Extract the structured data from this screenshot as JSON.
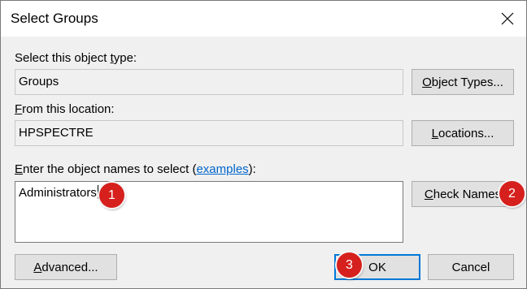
{
  "window": {
    "title": "Select Groups",
    "close_icon": "close-icon"
  },
  "object_type": {
    "label_pre": "Select this object ",
    "label_ul": "t",
    "label_post": "ype:",
    "value": "Groups",
    "button_pre": "",
    "button_ul": "O",
    "button_post": "bject Types..."
  },
  "location": {
    "label_pre": "",
    "label_ul": "F",
    "label_post": "rom this location:",
    "value": "HPSPECTRE",
    "button_pre": "",
    "button_ul": "L",
    "button_post": "ocations..."
  },
  "names": {
    "label_pre": "",
    "label_ul": "E",
    "label_post": "nter the object names to select (",
    "link": "examples",
    "label_end": "):",
    "value": "Administrators",
    "button_pre": "",
    "button_ul": "C",
    "button_post": "heck Names"
  },
  "footer": {
    "advanced_pre": "",
    "advanced_ul": "A",
    "advanced_post": "dvanced...",
    "ok": "OK",
    "cancel": "Cancel"
  },
  "callouts": {
    "step1": "1",
    "step2": "2",
    "step3": "3",
    "color": "#d6201d"
  },
  "colors": {
    "accent": "#0078d7",
    "link": "#0066cc"
  }
}
